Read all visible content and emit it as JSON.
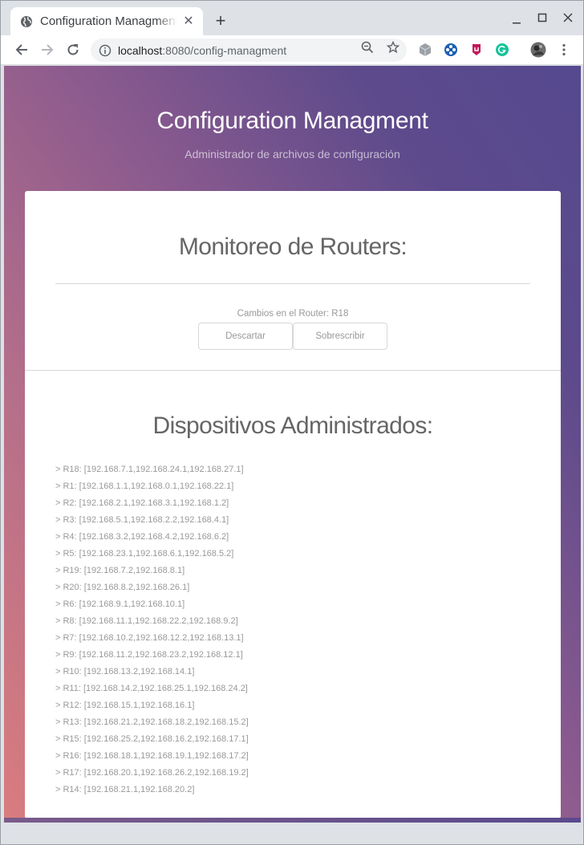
{
  "browser": {
    "tab_title": "Configuration Managment",
    "new_tab_label": "+",
    "address": {
      "host": "localhost",
      "rest": ":8080/config-managment"
    }
  },
  "header": {
    "title": "Configuration Managment",
    "subtitle": "Administrador de archivos de configuración"
  },
  "monitor": {
    "title": "Monitoreo de Routers:",
    "changes_text": "Cambios en el Router: R18",
    "discard_label": "Descartar",
    "overwrite_label": "Sobrescribir"
  },
  "devices": {
    "title": "Dispositivos Administrados:",
    "items": [
      "> R18: [192.168.7.1,192.168.24.1,192.168.27.1]",
      "> R1: [192.168.1.1,192.168.0.1,192.168.22.1]",
      "> R2: [192.168.2.1,192.168.3.1,192.168.1.2]",
      "> R3: [192.168.5.1,192.168.2.2,192.168.4.1]",
      "> R4: [192.168.3.2,192.168.4.2,192.168.6.2]",
      "> R5: [192.168.23.1,192.168.6.1,192.168.5.2]",
      "> R19: [192.168.7.2,192.168.8.1]",
      "> R20: [192.168.8.2,192.168.26.1]",
      "> R6: [192.168.9.1,192.168.10.1]",
      "> R8: [192.168.11.1,192.168.22.2,192.168.9.2]",
      "> R7: [192.168.10.2,192.168.12.2,192.168.13.1]",
      "> R9: [192.168.11.2,192.168.23.2,192.168.12.1]",
      "> R10: [192.168.13.2,192.168.14.1]",
      "> R11: [192.168.14.2,192.168.25.1,192.168.24.2]",
      "> R12: [192.168.15.1,192.168.16.1]",
      "> R13: [192.168.21.2,192.168.18.2,192.168.15.2]",
      "> R15: [192.168.25.2,192.168.16.2,192.168.17.1]",
      "> R16: [192.168.18.1,192.168.19.1,192.168.17.2]",
      "> R17: [192.168.20.1,192.168.26.2,192.168.19.2]",
      "> R14: [192.168.21.1,192.168.20.2]"
    ]
  },
  "colors": {
    "gradient_start": "#d97c7e",
    "gradient_end": "#564990",
    "card_bg": "#ffffff",
    "muted_text": "#999999"
  },
  "icons": [
    "globe-icon",
    "close-icon",
    "minimize-icon",
    "maximize-icon",
    "window-close-icon",
    "back-icon",
    "forward-icon",
    "reload-icon",
    "info-icon",
    "zoom-icon",
    "star-icon",
    "extension-icon",
    "avatar",
    "menu-icon"
  ]
}
